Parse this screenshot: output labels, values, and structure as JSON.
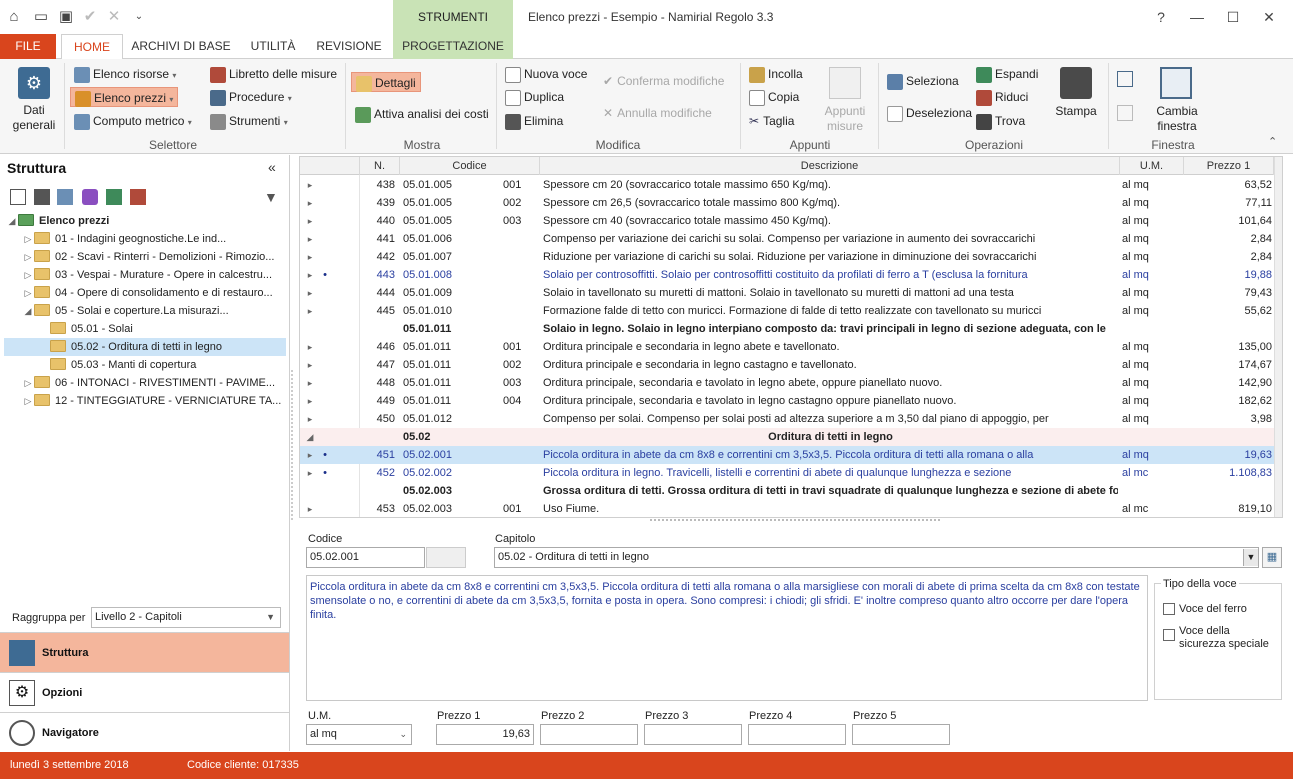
{
  "window": {
    "title": "Elenco prezzi - Esempio - Namirial Regolo 3.3",
    "context_tab_header": "STRUMENTI",
    "controls": [
      "?",
      "—",
      "☐",
      "✕"
    ]
  },
  "tabs": [
    {
      "label": "FILE"
    },
    {
      "label": "HOME"
    },
    {
      "label": "ARCHIVI DI BASE"
    },
    {
      "label": "UTILITÀ"
    },
    {
      "label": "REVISIONE"
    },
    {
      "label": "PROGETTAZIONE"
    }
  ],
  "ribbon": {
    "dati_generali": "Dati\ngenerali",
    "selettore": {
      "label": "Selettore",
      "elenco_risorse": "Elenco risorse",
      "elenco_prezzi": "Elenco prezzi",
      "computo_metrico": "Computo metrico",
      "libretto_misure": "Libretto delle misure",
      "procedure": "Procedure",
      "strumenti": "Strumenti"
    },
    "mostra": {
      "label": "Mostra",
      "dettagli": "Dettagli",
      "attiva_analisi": "Attiva analisi dei costi"
    },
    "modifica": {
      "label": "Modifica",
      "nuova_voce": "Nuova voce",
      "duplica": "Duplica",
      "elimina": "Elimina",
      "conferma": "Conferma modifiche",
      "annulla": "Annulla modifiche"
    },
    "appunti": {
      "label": "Appunti",
      "incolla": "Incolla",
      "copia": "Copia",
      "taglia": "Taglia",
      "appunti_misure": "Appunti\nmisure"
    },
    "operazioni": {
      "label": "Operazioni",
      "seleziona": "Seleziona",
      "deseleziona": "Deseleziona",
      "espandi": "Espandi",
      "riduci": "Riduci",
      "trova": "Trova",
      "stampa": "Stampa"
    },
    "finestra": {
      "label": "Finestra",
      "cambia": "Cambia\nfinestra"
    }
  },
  "left_pane": {
    "title": "Struttura",
    "collapse": "«",
    "tree": [
      {
        "label": "Elenco prezzi",
        "level": 0,
        "exp": "◢",
        "root": true
      },
      {
        "label": "01 - Indagini geognostiche.Le ind...",
        "level": 1,
        "exp": "▷"
      },
      {
        "label": "02 - Scavi - Rinterri - Demolizioni - Rimozio...",
        "level": 1,
        "exp": "▷"
      },
      {
        "label": "03 - Vespai - Murature - Opere in calcestru...",
        "level": 1,
        "exp": "▷"
      },
      {
        "label": "04 - Opere di consolidamento e di restauro...",
        "level": 1,
        "exp": "▷"
      },
      {
        "label": "05 - Solai e coperture.La misurazi...",
        "level": 1,
        "exp": "◢"
      },
      {
        "label": "05.01 - Solai",
        "level": 2,
        "exp": ""
      },
      {
        "label": "05.02 - Orditura di tetti in legno",
        "level": 2,
        "exp": "",
        "selected": true
      },
      {
        "label": "05.03 - Manti di copertura",
        "level": 2,
        "exp": ""
      },
      {
        "label": "06 - INTONACI - RIVESTIMENTI - PAVIME...",
        "level": 1,
        "exp": "▷"
      },
      {
        "label": "12 - TINTEGGIATURE - VERNICIATURE TA...",
        "level": 1,
        "exp": "▷"
      }
    ],
    "groupby_label": "Raggruppa per",
    "groupby_value": "Livello 2 - Capitoli",
    "nav": [
      {
        "label": "Struttura",
        "active": true
      },
      {
        "label": "Opzioni"
      },
      {
        "label": "Navigatore"
      }
    ]
  },
  "grid": {
    "headers": {
      "n": "N.",
      "codice": "Codice",
      "descrizione": "Descrizione",
      "um": "U.M.",
      "prezzo": "Prezzo 1"
    },
    "rows": [
      {
        "exp": "▸",
        "dot": "",
        "n": "438",
        "cod": "05.01.005",
        "sub": "001",
        "desc": "Spessore cm 20 (sovraccarico totale massimo 650 Kg/mq).",
        "um": "al mq",
        "pr": "63,52"
      },
      {
        "exp": "▸",
        "dot": "",
        "n": "439",
        "cod": "05.01.005",
        "sub": "002",
        "desc": "Spessore cm 26,5 (sovraccarico totale massimo 800 Kg/mq).",
        "um": "al mq",
        "pr": "77,11"
      },
      {
        "exp": "▸",
        "dot": "",
        "n": "440",
        "cod": "05.01.005",
        "sub": "003",
        "desc": "Spessore cm 40 (sovraccarico totale massimo 450 Kg/mq).",
        "um": "al mq",
        "pr": "101,64"
      },
      {
        "exp": "▸",
        "dot": "",
        "n": "441",
        "cod": "05.01.006",
        "sub": "",
        "desc": "Compenso per variazione dei carichi su solai. Compenso per variazione in aumento dei sovraccarichi",
        "um": "al mq",
        "pr": "2,84"
      },
      {
        "exp": "▸",
        "dot": "",
        "n": "442",
        "cod": "05.01.007",
        "sub": "",
        "desc": "Riduzione per variazione di carichi su solai. Riduzione per variazione in diminuzione dei sovraccarichi",
        "um": "al mq",
        "pr": "2,84"
      },
      {
        "exp": "▸",
        "dot": "•",
        "n": "443",
        "cod": "05.01.008",
        "sub": "",
        "desc": "Solaio per controsoffitti. Solaio per controsoffitti costituito da profilati di ferro a T (esclusa la fornitura",
        "um": "al mq",
        "pr": "19,88",
        "style": "blue"
      },
      {
        "exp": "▸",
        "dot": "",
        "n": "444",
        "cod": "05.01.009",
        "sub": "",
        "desc": "Solaio in tavellonato su muretti di mattoni. Solaio in tavellonato su muretti di mattoni ad una testa",
        "um": "al mq",
        "pr": "79,43"
      },
      {
        "exp": "▸",
        "dot": "",
        "n": "445",
        "cod": "05.01.010",
        "sub": "",
        "desc": "Formazione falde di tetto con muricci. Formazione di falde di tetto realizzate con tavellonato su muricci",
        "um": "al mq",
        "pr": "55,62"
      },
      {
        "exp": "",
        "dot": "",
        "n": "",
        "cod": "05.01.011",
        "sub": "",
        "desc": "Solaio in legno. Solaio in legno interpiano composto da: travi principali in legno di sezione adeguata, con le",
        "um": "",
        "pr": "",
        "style": "bold"
      },
      {
        "exp": "▸",
        "dot": "",
        "n": "446",
        "cod": "05.01.011",
        "sub": "001",
        "desc": "Orditura principale e secondaria in legno abete e tavellonato.",
        "um": "al mq",
        "pr": "135,00"
      },
      {
        "exp": "▸",
        "dot": "",
        "n": "447",
        "cod": "05.01.011",
        "sub": "002",
        "desc": "Orditura principale e secondaria in legno castagno e tavellonato.",
        "um": "al mq",
        "pr": "174,67"
      },
      {
        "exp": "▸",
        "dot": "",
        "n": "448",
        "cod": "05.01.011",
        "sub": "003",
        "desc": "Orditura principale, secondaria e tavolato in legno abete, oppure pianellato nuovo.",
        "um": "al mq",
        "pr": "142,90"
      },
      {
        "exp": "▸",
        "dot": "",
        "n": "449",
        "cod": "05.01.011",
        "sub": "004",
        "desc": "Orditura principale, secondaria e tavolato in legno castagno oppure pianellato nuovo.",
        "um": "al mq",
        "pr": "182,62"
      },
      {
        "exp": "▸",
        "dot": "",
        "n": "450",
        "cod": "05.01.012",
        "sub": "",
        "desc": "Compenso per solai. Compenso per solai posti ad altezza superiore a m 3,50 dal piano di appoggio, per",
        "um": "al mq",
        "pr": "3,98"
      },
      {
        "exp": "◢",
        "dot": "",
        "n": "",
        "cod": "05.02",
        "sub": "",
        "desc": "Orditura di tetti in legno",
        "um": "",
        "pr": "",
        "style": "grp"
      },
      {
        "exp": "▸",
        "dot": "•",
        "n": "451",
        "cod": "05.02.001",
        "sub": "",
        "desc": "Piccola orditura in abete da cm 8x8 e correntini cm 3,5x3,5. Piccola orditura di tetti alla romana o alla",
        "um": "al mq",
        "pr": "19,63",
        "style": "selblue"
      },
      {
        "exp": "▸",
        "dot": "•",
        "n": "452",
        "cod": "05.02.002",
        "sub": "",
        "desc": "Piccola orditura in legno. Travicelli, listelli e correntini di abete di qualunque lunghezza e sezione",
        "um": "al mc",
        "pr": "1.108,83",
        "style": "blue"
      },
      {
        "exp": "",
        "dot": "",
        "n": "",
        "cod": "05.02.003",
        "sub": "",
        "desc": "Grossa orditura di tetti. Grossa orditura di tetti in travi squadrate di qualunque lunghezza e sezione di abete forniti e",
        "um": "",
        "pr": "",
        "style": "bold"
      },
      {
        "exp": "▸",
        "dot": "",
        "n": "453",
        "cod": "05.02.003",
        "sub": "001",
        "desc": "Uso Fiume.",
        "um": "al mc",
        "pr": "819,10"
      }
    ]
  },
  "detail": {
    "codice_label": "Codice",
    "codice_value": "05.02.001",
    "capitolo_label": "Capitolo",
    "capitolo_value": "05.02 - Orditura di tetti in legno",
    "description": "Piccola orditura in abete da cm 8x8 e correntini cm 3,5x3,5. Piccola orditura di tetti alla romana o alla marsigliese con morali di abete di prima scelta da cm 8x8 con testate smensolate o no, e correntini di abete da cm 3,5x3,5, fornita e posta in opera. Sono compresi: i chiodi; gli sfridi. E' inoltre compreso quanto altro occorre per dare l'opera finita.",
    "tipo_voce_label": "Tipo della voce",
    "voce_ferro": "Voce del ferro",
    "voce_sicurezza": "Voce della sicurezza speciale",
    "um_label": "U.M.",
    "um_value": "al mq",
    "prezzo1_label": "Prezzo 1",
    "prezzo1_value": "19,63",
    "prezzo2_label": "Prezzo 2",
    "prezzo3_label": "Prezzo 3",
    "prezzo4_label": "Prezzo 4",
    "prezzo5_label": "Prezzo 5"
  },
  "status": {
    "date": "lunedì 3 settembre 2018",
    "client_code": "Codice cliente: 017335"
  },
  "colors": {
    "accent": "#d9451d",
    "selection": "#f4b69c",
    "context": "#c9e3b6",
    "row_blue": "#2a3fa0"
  }
}
